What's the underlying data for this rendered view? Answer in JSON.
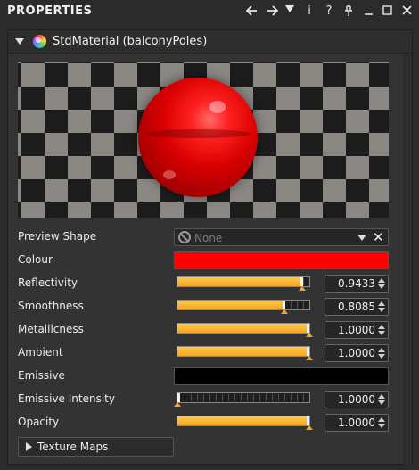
{
  "window": {
    "title": "PROPERTIES"
  },
  "toolbar": {
    "back_icon": "arrow-left-icon",
    "forward_icon": "arrow-right-icon",
    "menu_icon": "caret-down-icon",
    "info_icon": "info-icon",
    "help_icon": "question-icon",
    "pin_icon": "pin-icon",
    "minimize_icon": "minimize-icon",
    "maximize_icon": "maximize-icon",
    "close_icon": "close-icon",
    "info_glyph": "i",
    "help_glyph": "?"
  },
  "material": {
    "header": "StdMaterial (balconyPoles)"
  },
  "properties": {
    "preview_shape": {
      "label": "Preview Shape",
      "value": "None"
    },
    "colour": {
      "label": "Colour",
      "color": "#ff0000"
    },
    "reflectivity": {
      "label": "Reflectivity",
      "value": "0.9433",
      "fraction": 0.9433
    },
    "smoothness": {
      "label": "Smoothness",
      "value": "0.8085",
      "fraction": 0.8085
    },
    "metallicness": {
      "label": "Metallicness",
      "value": "1.0000",
      "fraction": 1.0
    },
    "ambient": {
      "label": "Ambient",
      "value": "1.0000",
      "fraction": 1.0
    },
    "emissive": {
      "label": "Emissive",
      "color": "#000000"
    },
    "emissive_intensity": {
      "label": "Emissive Intensity",
      "value": "1.0000",
      "fraction": 0.0
    },
    "opacity": {
      "label": "Opacity",
      "value": "1.0000",
      "fraction": 1.0
    }
  },
  "texture_maps": {
    "label": "Texture Maps"
  },
  "colors": {
    "accent": "#f5a623",
    "panel_bg": "#333333",
    "window_bg": "#2b2b2b"
  }
}
